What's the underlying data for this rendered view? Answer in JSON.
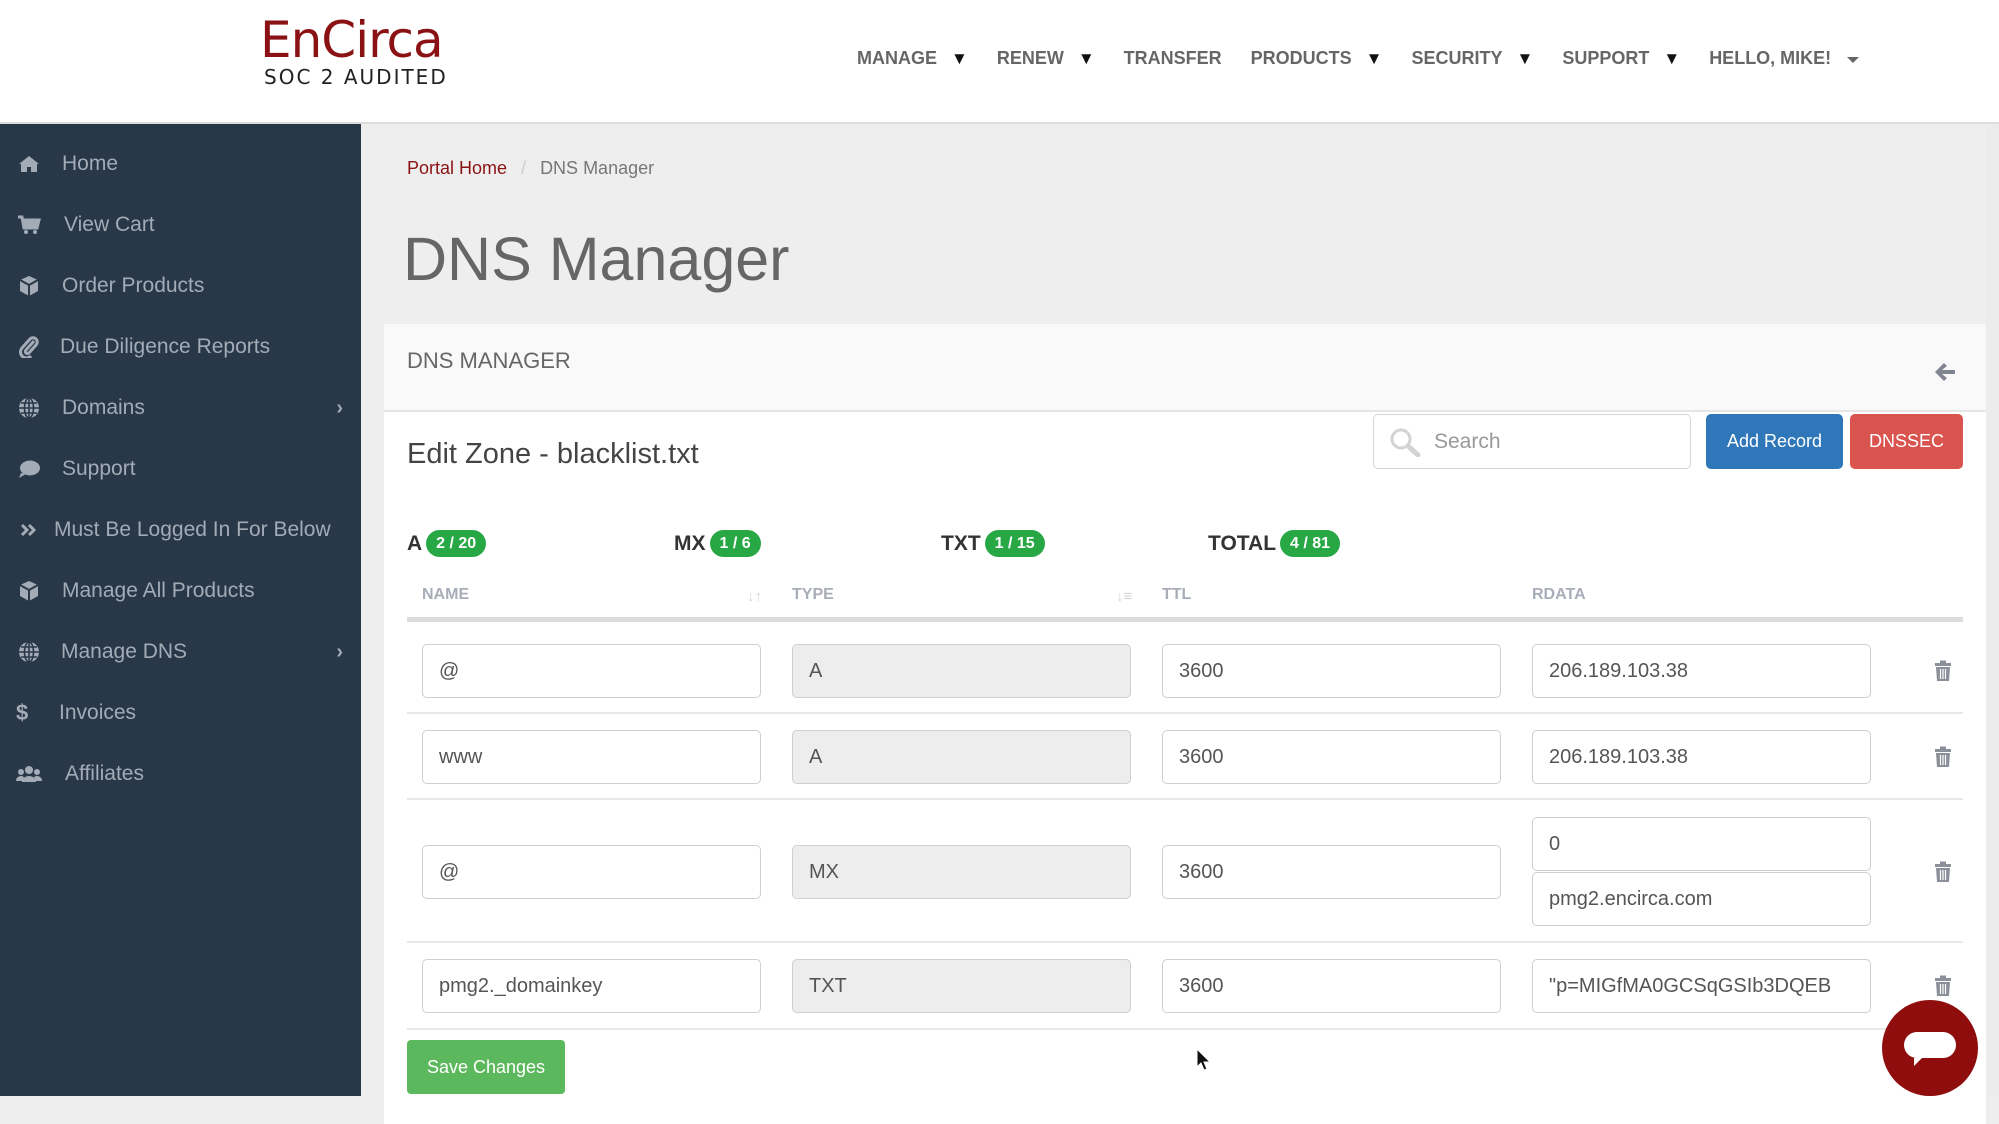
{
  "brand": {
    "name": "EnCirca",
    "tagline": "SOC 2 AUDITED",
    "color": "#8b1214"
  },
  "topnav": {
    "items": [
      {
        "label": "MANAGE",
        "dropdown": true
      },
      {
        "label": "RENEW",
        "dropdown": true
      },
      {
        "label": "TRANSFER",
        "dropdown": false
      },
      {
        "label": "PRODUCTS",
        "dropdown": true
      },
      {
        "label": "SECURITY",
        "dropdown": true
      },
      {
        "label": "SUPPORT",
        "dropdown": true
      }
    ],
    "dropdown_glyph": "▼",
    "user_greeting": "HELLO, MIKE!"
  },
  "sidebar": {
    "items": [
      {
        "label": "Home",
        "icon": "home-icon"
      },
      {
        "label": "View Cart",
        "icon": "cart-icon"
      },
      {
        "label": "Order Products",
        "icon": "cube-icon"
      },
      {
        "label": "Due Diligence Reports",
        "icon": "paperclip-icon"
      },
      {
        "label": "Domains",
        "icon": "globe-icon",
        "submenu": true
      },
      {
        "label": "Support",
        "icon": "comment-icon"
      },
      {
        "label": "Must Be Logged In For Below",
        "icon": "double-chevron-icon"
      },
      {
        "label": "Manage All Products",
        "icon": "cube-icon"
      },
      {
        "label": "Manage DNS",
        "icon": "globe-icon",
        "submenu": true
      },
      {
        "label": "Invoices",
        "icon": "dollar-icon"
      },
      {
        "label": "Affiliates",
        "icon": "users-icon"
      }
    ],
    "chevron_glyph": "›"
  },
  "breadcrumb": {
    "home": "Portal Home",
    "separator": "/",
    "current": "DNS Manager"
  },
  "page_title": "DNS Manager",
  "card": {
    "header": "DNS MANAGER",
    "zone_title": "Edit Zone - blacklist.txt",
    "search_placeholder": "Search",
    "add_record_label": "Add Record",
    "dnssec_label": "DNSSEC",
    "counters": [
      {
        "label": "A",
        "value": "2 / 20"
      },
      {
        "label": "MX",
        "value": "1 / 6"
      },
      {
        "label": "TXT",
        "value": "1 / 15"
      },
      {
        "label": "TOTAL",
        "value": "4 / 81"
      }
    ],
    "columns": [
      "NAME",
      "TYPE",
      "TTL",
      "RDATA"
    ],
    "records": [
      {
        "name": "@",
        "type": "A",
        "ttl": "3600",
        "rdata": [
          "206.189.103.38"
        ]
      },
      {
        "name": "www",
        "type": "A",
        "ttl": "3600",
        "rdata": [
          "206.189.103.38"
        ]
      },
      {
        "name": "@",
        "type": "MX",
        "ttl": "3600",
        "rdata": [
          "0",
          "pmg2.encirca.com"
        ]
      },
      {
        "name": "pmg2._domainkey",
        "type": "TXT",
        "ttl": "3600",
        "rdata": [
          "\"p=MIGfMA0GCSqGSIb3DQEB"
        ]
      }
    ],
    "save_label": "Save Changes"
  },
  "colors": {
    "sidebar_bg": "#283849",
    "primary": "#2f77b9",
    "danger": "#d9534f",
    "success": "#5cb85c",
    "badge": "#28a745",
    "chat": "#8f0d0d"
  }
}
